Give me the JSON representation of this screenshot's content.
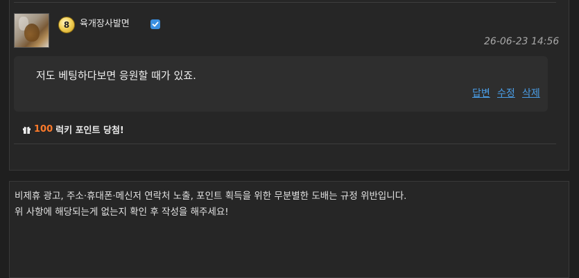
{
  "comment": {
    "username": "육개장사발면",
    "level": "8",
    "timestamp": "26-06-23 14:56",
    "text": "저도 베팅하다보면 응원할 때가 있죠.",
    "actions": {
      "reply": "답변",
      "edit": "수정",
      "delete": "삭제"
    }
  },
  "lucky_point": {
    "amount": "100",
    "label": "럭키 포인트 당첨!"
  },
  "notice": {
    "line1": "비제휴 광고, 주소·휴대폰·메신저 연락처 노출, 포인트 획득을 위한 무분별한 도배는 규정 위반입니다.",
    "line2": "위 사항에 해당되는게 없는지 확인 후 작성을 해주세요!"
  },
  "colors": {
    "link": "#4a9de6",
    "points": "#ff7a2a",
    "verified": "#3b8fe0"
  }
}
